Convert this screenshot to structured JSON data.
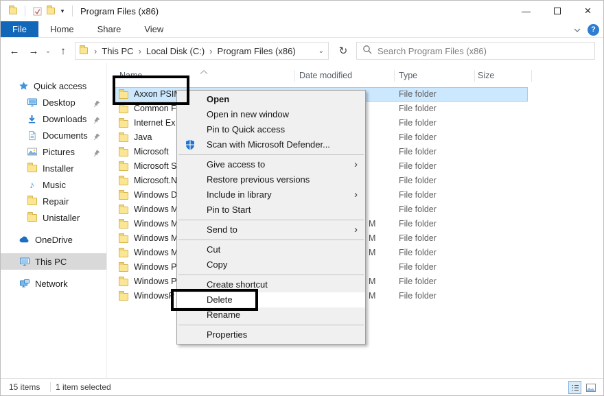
{
  "colors": {
    "accent_blue": "#1267b8",
    "selection_bg": "#cce8ff",
    "selection_border": "#9bd0f5",
    "menu_bg": "#f0f0f0",
    "folder_yellow": "#fbe694",
    "sidebar_selected": "#d9d9d9"
  },
  "titlebar": {
    "title": "Program Files (x86)",
    "qat_dropdown_glyph": "▾",
    "controls": {
      "minimize": "—",
      "close": "×"
    }
  },
  "ribbon": {
    "tabs": [
      "File",
      "Home",
      "Share",
      "View"
    ],
    "active_tab": "File",
    "help_glyph": "?"
  },
  "navbar": {
    "icons": {
      "back": "←",
      "forward": "→",
      "up": "↑",
      "refresh": "↻",
      "dropdown": "⌄"
    },
    "breadcrumb": [
      "This PC",
      "Local Disk (C:)",
      "Program Files (x86)"
    ],
    "separator_glyph": "›",
    "search_placeholder": "Search Program Files (x86)"
  },
  "sidebar": {
    "items": [
      {
        "label": "Quick access"
      },
      {
        "label": "Desktop"
      },
      {
        "label": "Downloads"
      },
      {
        "label": "Documents"
      },
      {
        "label": "Pictures"
      },
      {
        "label": "Installer"
      },
      {
        "label": "Music"
      },
      {
        "label": "Repair"
      },
      {
        "label": "Unistaller"
      },
      {
        "label": "OneDrive"
      },
      {
        "label": "This PC",
        "selected": true
      },
      {
        "label": "Network"
      }
    ]
  },
  "file_list": {
    "columns": [
      "Name",
      "Date modified",
      "Type",
      "Size"
    ],
    "rows": [
      {
        "name": "Axxon PSIM",
        "type": "File folder",
        "date_tail": "",
        "selected": true
      },
      {
        "name": "Common F",
        "type": "File folder",
        "date_tail": ""
      },
      {
        "name": "Internet Ex",
        "type": "File folder",
        "date_tail": ""
      },
      {
        "name": "Java",
        "type": "File folder",
        "date_tail": ""
      },
      {
        "name": "Microsoft",
        "type": "File folder",
        "date_tail": ""
      },
      {
        "name": "Microsoft S",
        "type": "File folder",
        "date_tail": ""
      },
      {
        "name": "Microsoft.N",
        "type": "File folder",
        "date_tail": ""
      },
      {
        "name": "Windows D",
        "type": "File folder",
        "date_tail": ""
      },
      {
        "name": "Windows M",
        "type": "File folder",
        "date_tail": ""
      },
      {
        "name": "Windows M",
        "type": "File folder",
        "date_tail": "M"
      },
      {
        "name": "Windows M",
        "type": "File folder",
        "date_tail": "M"
      },
      {
        "name": "Windows M",
        "type": "File folder",
        "date_tail": "M"
      },
      {
        "name": "Windows P",
        "type": "File folder",
        "date_tail": ""
      },
      {
        "name": "Windows P",
        "type": "File folder",
        "date_tail": "M"
      },
      {
        "name": "WindowsP",
        "type": "File folder",
        "date_tail": "M"
      }
    ]
  },
  "context_menu": {
    "submenu_glyph": "›",
    "items": [
      {
        "label": "Open"
      },
      {
        "label": "Open in new window"
      },
      {
        "label": "Pin to Quick access"
      },
      {
        "label": "Scan with Microsoft Defender..."
      },
      {
        "label": "Give access to"
      },
      {
        "label": "Restore previous versions"
      },
      {
        "label": "Include in library"
      },
      {
        "label": "Pin to Start"
      },
      {
        "label": "Send to"
      },
      {
        "label": "Cut"
      },
      {
        "label": "Copy"
      },
      {
        "label": "Create shortcut"
      },
      {
        "label": "Delete"
      },
      {
        "label": "Rename"
      },
      {
        "label": "Properties"
      }
    ]
  },
  "status_bar": {
    "items_text": "15 items",
    "selection_text": "1 item selected"
  }
}
